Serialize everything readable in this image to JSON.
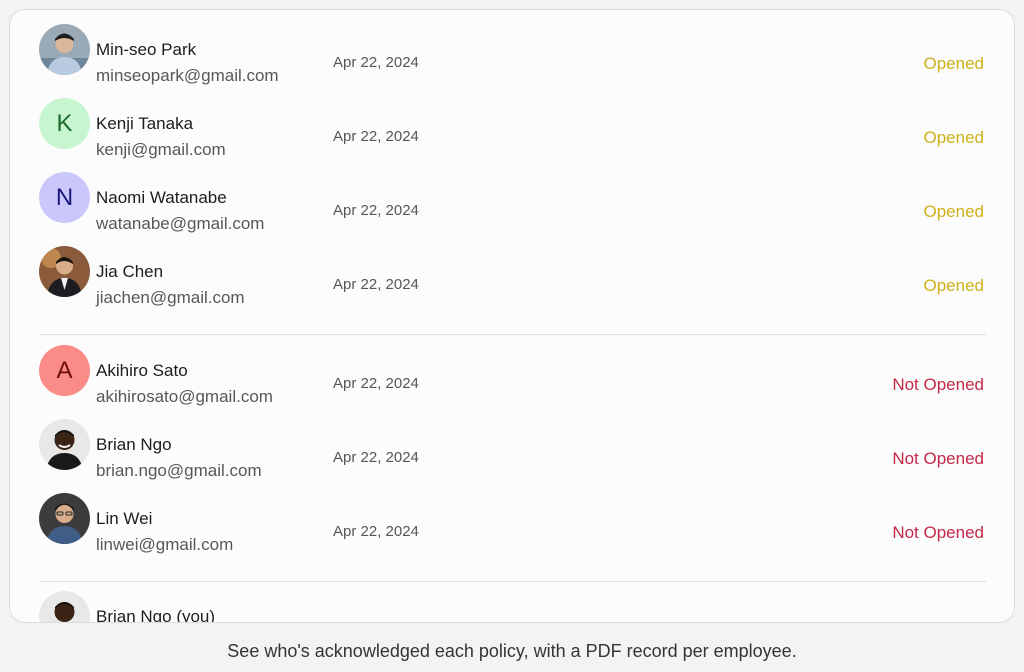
{
  "colors": {
    "opened": "#cdb11a",
    "not_opened": "#c42848"
  },
  "opened_group": [
    {
      "name": "Min-seo Park",
      "email": "minseopark@gmail.com",
      "date": "Apr 22, 2024",
      "status": "Opened",
      "avatar": {
        "type": "photo",
        "icon": "person-photo"
      }
    },
    {
      "name": "Kenji Tanaka",
      "email": "kenji@gmail.com",
      "date": "Apr 22, 2024",
      "status": "Opened",
      "avatar": {
        "type": "initial",
        "initial": "K",
        "bg": "#c6f5cf",
        "fg": "#1c6b2c"
      }
    },
    {
      "name": "Naomi Watanabe",
      "email": "watanabe@gmail.com",
      "date": "Apr 22, 2024",
      "status": "Opened",
      "avatar": {
        "type": "initial",
        "initial": "N",
        "bg": "#c9c7fb",
        "fg": "#1d1a7a"
      }
    },
    {
      "name": "Jia Chen",
      "email": "jiachen@gmail.com",
      "date": "Apr 22, 2024",
      "status": "Opened",
      "avatar": {
        "type": "photo",
        "icon": "person-photo"
      }
    }
  ],
  "not_opened_group": [
    {
      "name": "Akihiro Sato",
      "email": "akihirosato@gmail.com",
      "date": "Apr 22, 2024",
      "status": "Not Opened",
      "avatar": {
        "type": "initial",
        "initial": "A",
        "bg": "#fb8b86",
        "fg": "#6b0f0f"
      }
    },
    {
      "name": "Brian Ngo",
      "email": "brian.ngo@gmail.com",
      "date": "Apr 22, 2024",
      "status": "Not Opened",
      "avatar": {
        "type": "photo",
        "icon": "person-photo"
      }
    },
    {
      "name": "Lin Wei",
      "email": "linwei@gmail.com",
      "date": "Apr 22, 2024",
      "status": "Not Opened",
      "avatar": {
        "type": "photo",
        "icon": "person-photo"
      }
    }
  ],
  "self_row": {
    "name": "Brian Ngo (you)",
    "avatar": {
      "type": "photo",
      "icon": "person-photo"
    }
  },
  "caption": "See who's acknowledged each policy, with a PDF record per employee."
}
